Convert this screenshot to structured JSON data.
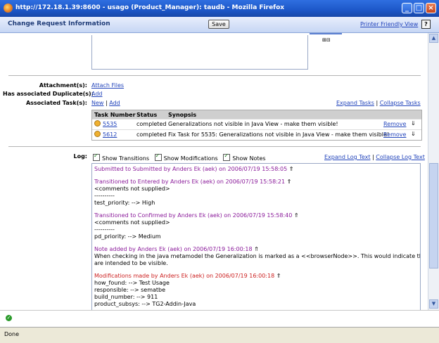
{
  "window": {
    "title": "http://172.18.1.39:8600 - usago (Product_Manager): taudb - Mozilla Firefox",
    "minimize": "_",
    "maximize": "□",
    "close": "×"
  },
  "header": {
    "title": "Change Request Information",
    "save_label": "Save",
    "printer_friendly": "Printer Friendly View",
    "help": "?"
  },
  "description": {
    "expand_collapse": "⊞⊟"
  },
  "attachments": {
    "label": "Attachment(s):",
    "link": "Attach Files"
  },
  "duplicates": {
    "label": "Has associated Duplicate(s):",
    "link": "Add"
  },
  "tasks": {
    "label": "Associated Task(s):",
    "new_link": "New",
    "sep": "|",
    "add_link": "Add",
    "expand_all": "Expand Tasks",
    "collapse_all": "Collapse Tasks",
    "columns": {
      "number": "Task Number",
      "status": "Status",
      "synopsis": "Synopsis"
    },
    "rows": [
      {
        "number": "5535",
        "status": "completed",
        "synopsis": "Generalizations not visible in Java View - make them visible!",
        "remove": "Remove"
      },
      {
        "number": "5612",
        "status": "completed",
        "synopsis": "Fix Task for 5535: Generalizations not visible in Java View - make them visible!",
        "remove": "Remove"
      }
    ]
  },
  "log": {
    "label": "Log:",
    "show_transitions": "Show Transitions",
    "show_modifications": "Show Modifications",
    "show_notes": "Show Notes",
    "expand": "Expand Log Text",
    "collapse": "Collapse Log Text",
    "entries": [
      {
        "head": "Submitted to Submitted by Anders Ek (aek) on 2006/07/19 15:58:05"
      },
      {
        "head": "Transitioned to Entered by Anders Ek (aek) on 2006/07/19 15:58:21",
        "lines": [
          "<comments not supplied>",
          "----------",
          "test_priority: --> High"
        ]
      },
      {
        "head": "Transitioned to Confirmed by Anders Ek (aek) on 2006/07/19 15:58:40",
        "lines": [
          "<comments not supplied>",
          "----------",
          "pd_priority: --> Medium"
        ]
      },
      {
        "head": "Note added by Anders Ek (aek) on 2006/07/19 16:00:18",
        "lines": [
          "When checking in the java metamodel the Generalization is marked as a <<browserNode>>. This would indicate that they",
          "are intended to be visible."
        ]
      },
      {
        "head": "Modifications made by Anders Ek (aek) on 2006/07/19 16:00:18",
        "lines": [
          "how_found: --> Test Usage",
          "responsible: --> sematbe",
          "build_number: --> 911",
          "product_subsys: --> TG2-Addin-Java"
        ]
      }
    ]
  },
  "statusbar": {
    "text": "Done"
  },
  "icons": {
    "expand": "⇑",
    "row_toggle": "⇓"
  }
}
